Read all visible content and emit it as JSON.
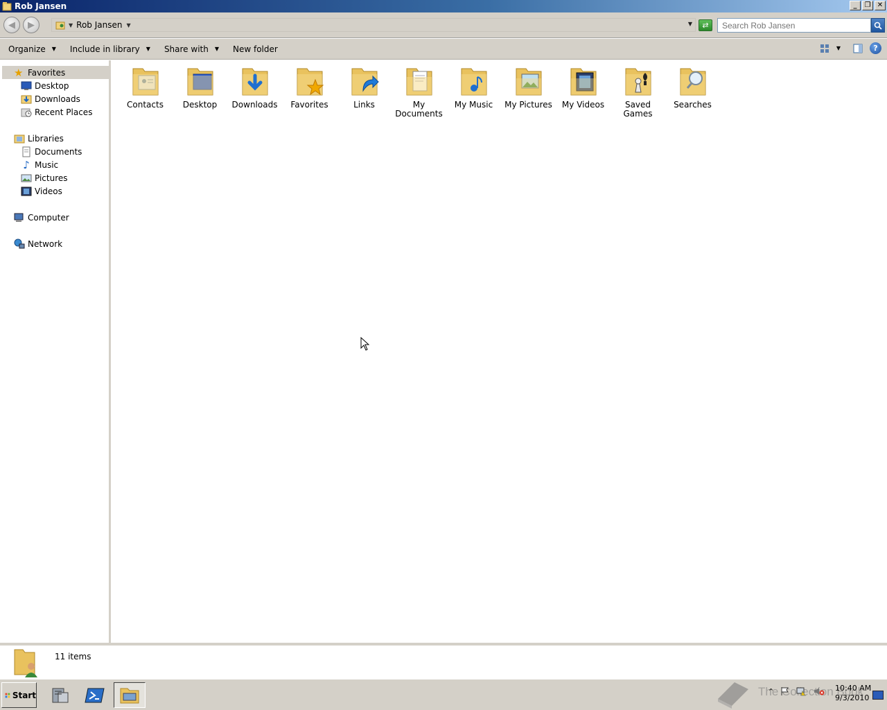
{
  "window": {
    "title": "Rob Jansen"
  },
  "address": {
    "crumbs": [
      "Rob Jansen"
    ]
  },
  "search": {
    "placeholder": "Search Rob Jansen"
  },
  "toolbar": {
    "organize": "Organize",
    "include_in_library": "Include in library",
    "share_with": "Share with",
    "new_folder": "New folder"
  },
  "nav": {
    "favorites": {
      "label": "Favorites",
      "items": [
        "Desktop",
        "Downloads",
        "Recent Places"
      ]
    },
    "libraries": {
      "label": "Libraries",
      "items": [
        "Documents",
        "Music",
        "Pictures",
        "Videos"
      ]
    },
    "computer": "Computer",
    "network": "Network"
  },
  "folders": [
    {
      "label": "Contacts",
      "icon": "contacts-folder-icon"
    },
    {
      "label": "Desktop",
      "icon": "desktop-folder-icon"
    },
    {
      "label": "Downloads",
      "icon": "downloads-folder-icon"
    },
    {
      "label": "Favorites",
      "icon": "favorites-folder-icon"
    },
    {
      "label": "Links",
      "icon": "links-folder-icon"
    },
    {
      "label": "My Documents",
      "icon": "documents-folder-icon"
    },
    {
      "label": "My Music",
      "icon": "music-folder-icon"
    },
    {
      "label": "My Pictures",
      "icon": "pictures-folder-icon"
    },
    {
      "label": "My Videos",
      "icon": "videos-folder-icon"
    },
    {
      "label": "Saved Games",
      "icon": "games-folder-icon"
    },
    {
      "label": "Searches",
      "icon": "searches-folder-icon"
    }
  ],
  "details": {
    "count": "11 items"
  },
  "taskbar": {
    "start": "Start",
    "clock_time": "10:40 AM",
    "clock_date": "9/3/2010",
    "watermark": "The Collection Book"
  },
  "colors": {
    "titlebar_start": "#0a246a",
    "folder_yellow": "#f2d27a",
    "chrome_gray": "#d4d0c8"
  }
}
